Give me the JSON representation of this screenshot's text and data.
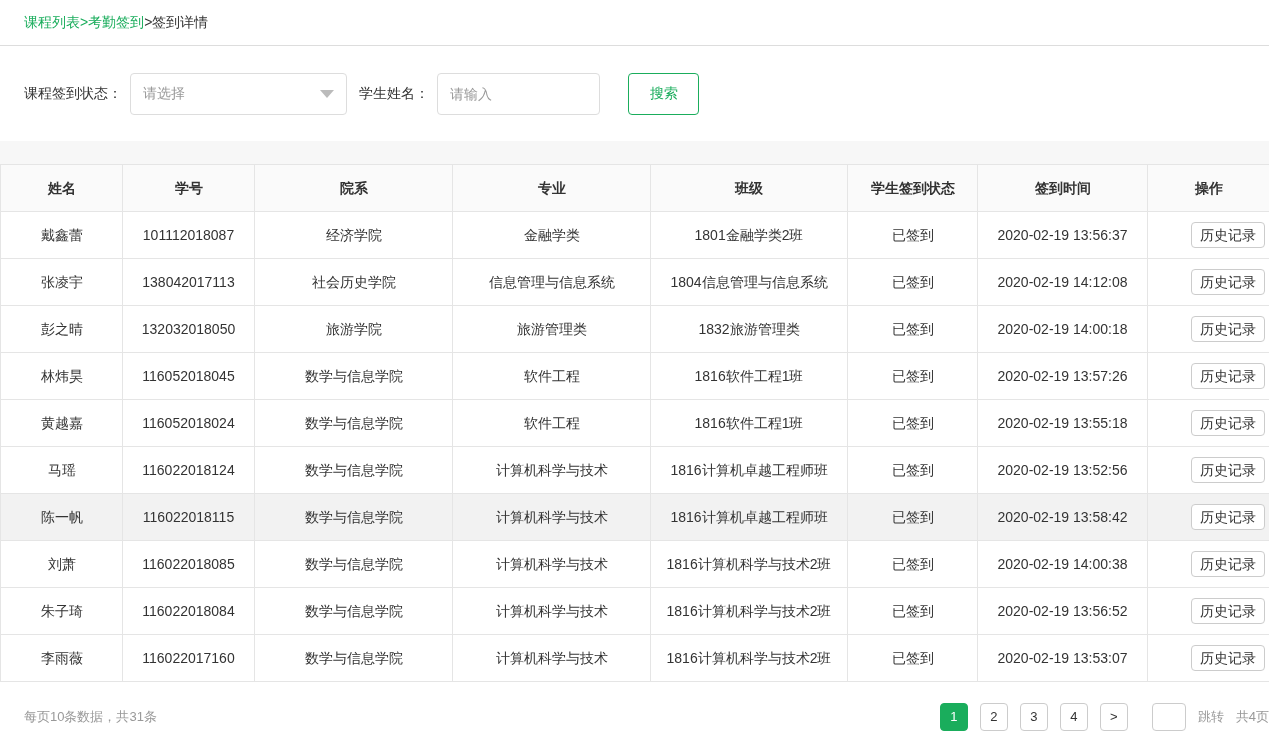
{
  "breadcrumb": [
    {
      "text": "课程列表>",
      "link": true
    },
    {
      "text": "考勤签到",
      "link": true
    },
    {
      "text": ">签到详情",
      "link": false
    }
  ],
  "filters": {
    "status_label": "课程签到状态：",
    "status_select": {
      "placeholder": "请选择"
    },
    "name_label": "学生姓名：",
    "name_field": {
      "placeholder": "请输入"
    },
    "search_button": "搜索"
  },
  "table": {
    "columns": [
      "姓名",
      "学号",
      "院系",
      "专业",
      "班级",
      "学生签到状态",
      "签到时间",
      "操作"
    ],
    "rows": [
      {
        "cells": [
          "戴鑫蕾",
          "101112018087",
          "经济学院",
          "金融学类",
          "1801金融学类2班",
          "已签到",
          "2020-02-19 13:56:37"
        ],
        "action": "历史记录",
        "hovered": false
      },
      {
        "cells": [
          "张凌宇",
          "138042017113",
          "社会历史学院",
          "信息管理与信息系统",
          "1804信息管理与信息系统",
          "已签到",
          "2020-02-19 14:12:08"
        ],
        "action": "历史记录",
        "hovered": false
      },
      {
        "cells": [
          "彭之晴",
          "132032018050",
          "旅游学院",
          "旅游管理类",
          "1832旅游管理类",
          "已签到",
          "2020-02-19 14:00:18"
        ],
        "action": "历史记录",
        "hovered": false
      },
      {
        "cells": [
          "林炜昊",
          "116052018045",
          "数学与信息学院",
          "软件工程",
          "1816软件工程1班",
          "已签到",
          "2020-02-19 13:57:26"
        ],
        "action": "历史记录",
        "hovered": false
      },
      {
        "cells": [
          "黄越嘉",
          "116052018024",
          "数学与信息学院",
          "软件工程",
          "1816软件工程1班",
          "已签到",
          "2020-02-19 13:55:18"
        ],
        "action": "历史记录",
        "hovered": false
      },
      {
        "cells": [
          "马瑶",
          "116022018124",
          "数学与信息学院",
          "计算机科学与技术",
          "1816计算机卓越工程师班",
          "已签到",
          "2020-02-19 13:52:56"
        ],
        "action": "历史记录",
        "hovered": false
      },
      {
        "cells": [
          "陈一帆",
          "116022018115",
          "数学与信息学院",
          "计算机科学与技术",
          "1816计算机卓越工程师班",
          "已签到",
          "2020-02-19 13:58:42"
        ],
        "action": "历史记录",
        "hovered": true
      },
      {
        "cells": [
          "刘萧",
          "116022018085",
          "数学与信息学院",
          "计算机科学与技术",
          "1816计算机科学与技术2班",
          "已签到",
          "2020-02-19 14:00:38"
        ],
        "action": "历史记录",
        "hovered": false
      },
      {
        "cells": [
          "朱子琦",
          "116022018084",
          "数学与信息学院",
          "计算机科学与技术",
          "1816计算机科学与技术2班",
          "已签到",
          "2020-02-19 13:56:52"
        ],
        "action": "历史记录",
        "hovered": false
      },
      {
        "cells": [
          "李雨薇",
          "116022017160",
          "数学与信息学院",
          "计算机科学与技术",
          "1816计算机科学与技术2班",
          "已签到",
          "2020-02-19 13:53:07"
        ],
        "action": "历史记录",
        "hovered": false
      }
    ]
  },
  "pagination": {
    "summary": "每页10条数据，共31条",
    "pages": [
      {
        "label": "1",
        "selected": true
      },
      {
        "label": "2",
        "selected": false
      },
      {
        "label": "3",
        "selected": false
      },
      {
        "label": "4",
        "selected": false
      }
    ],
    "next": ">",
    "jump_button": "跳转",
    "total": "共4页"
  }
}
